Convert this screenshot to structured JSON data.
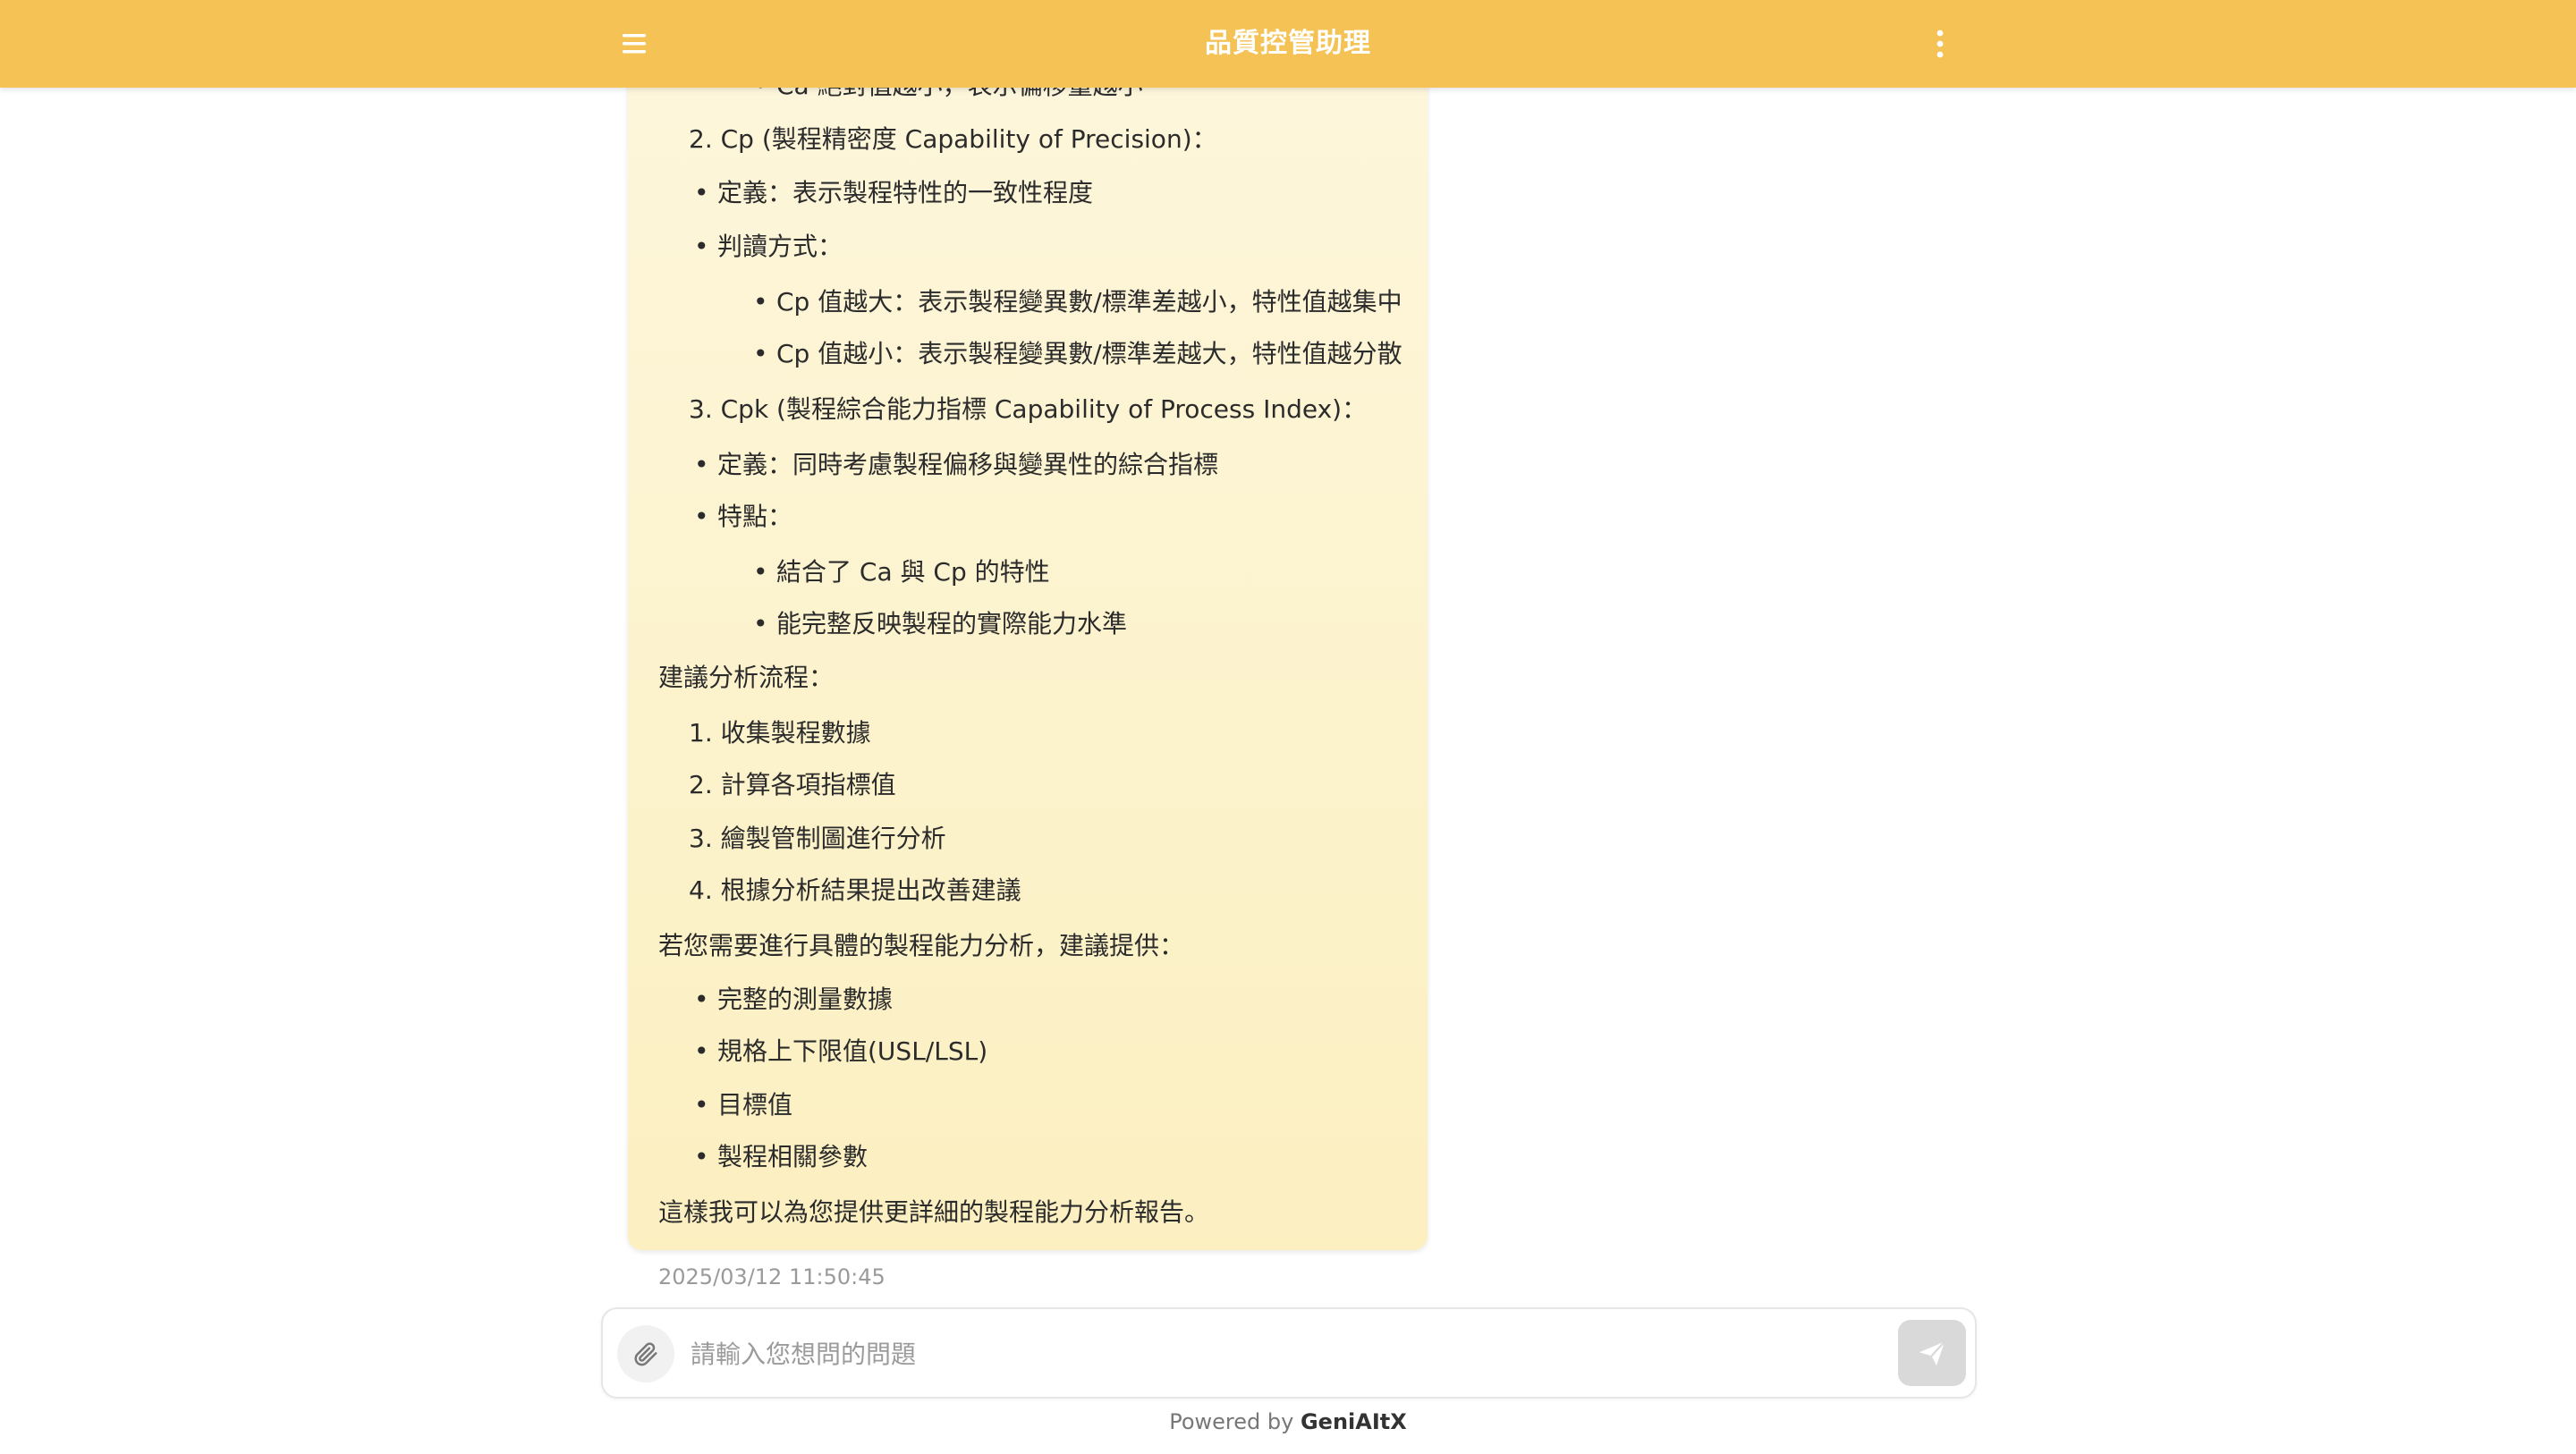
{
  "header": {
    "title": "品質控管助理",
    "menu_icon": "menu-icon",
    "more_icon": "more-vertical-icon"
  },
  "colors": {
    "header": "#f4c255",
    "bubble": "#fcf0c1"
  },
  "message": {
    "lines": [
      "Ca 絕對值越小，表示偏移量越小",
      "2. Cp (製程精密度 Capability of Precision)：",
      "定義：表示製程特性的一致性程度",
      "判讀方式：",
      "Cp 值越大：表示製程變異數/標準差越小，特性值越集中",
      "Cp 值越小：表示製程變異數/標準差越大，特性值越分散",
      "3. Cpk (製程綜合能力指標 Capability of Process Index)：",
      "定義：同時考慮製程偏移與變異性的綜合指標",
      "特點：",
      "結合了 Ca 與 Cp 的特性",
      "能完整反映製程的實際能力水準",
      "建議分析流程：",
      "1. 收集製程數據",
      "2. 計算各項指標值",
      "3. 繪製管制圖進行分析",
      "4. 根據分析結果提出改善建議",
      "若您需要進行具體的製程能力分析，建議提供：",
      "完整的測量數據",
      "規格上下限值(USL/LSL)",
      "目標值",
      "製程相關參數",
      "這樣我可以為您提供更詳細的製程能力分析報告。"
    ],
    "timestamp": "2025/03/12 11:50:45"
  },
  "composer": {
    "placeholder": "請輸入您想問的問題",
    "attach_icon": "paperclip-icon",
    "send_icon": "send-icon"
  },
  "footer": {
    "powered_by": "Powered by",
    "brand": "GeniAItX"
  }
}
